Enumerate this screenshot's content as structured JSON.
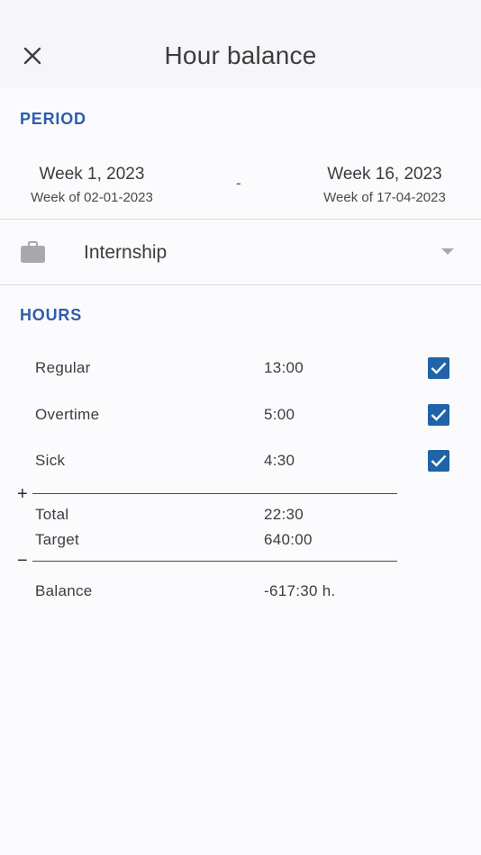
{
  "header": {
    "title": "Hour balance"
  },
  "period": {
    "label": "PERIOD",
    "start": {
      "week": "Week 1, 2023",
      "sub": "Week of 02-01-2023"
    },
    "separator": "-",
    "end": {
      "week": "Week 16, 2023",
      "sub": "Week of 17-04-2023"
    }
  },
  "job": {
    "label": "Internship",
    "icon": "briefcase-icon"
  },
  "hours": {
    "label": "HOURS",
    "rows": [
      {
        "label": "Regular",
        "value": "13:00",
        "checked": true
      },
      {
        "label": "Overtime",
        "value": "5:00",
        "checked": true
      },
      {
        "label": "Sick",
        "value": "4:30",
        "checked": true
      }
    ],
    "plus_sign": "+",
    "minus_sign": "−",
    "total": {
      "label": "Total",
      "value": "22:30"
    },
    "target": {
      "label": "Target",
      "value": "640:00"
    },
    "balance": {
      "label": "Balance",
      "value": "-617:30 h."
    }
  },
  "colors": {
    "accent": "#2e5cab",
    "checkbox": "#1f63a8",
    "text": "#3c3c3f",
    "header_bg": "#f6f6f8"
  }
}
